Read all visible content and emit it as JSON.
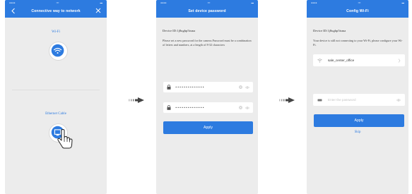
{
  "colors": {
    "accent": "#2d7be0",
    "background": "#ececec",
    "field": "#ffffff"
  },
  "screen1": {
    "title": "Connective way to network",
    "wifi_label": "Wi-Fi",
    "ethernet_label": "Ethernet Cable",
    "icons": [
      "back-chevron-icon",
      "close-icon",
      "wifi-icon",
      "ethernet-icon",
      "hand-pointer-icon"
    ]
  },
  "screen2": {
    "title": "Set device password",
    "device_id": "Device ID:1j8ughp5tsma",
    "description": "Please set a new password for the camera.Password must be a combination of letters and numbers, at a length of 8-32 characters",
    "password_mask": "••••••••••••••",
    "confirm_mask": "••••••••••••••",
    "apply_label": "Apply",
    "icons": [
      "lock-icon",
      "clear-icon",
      "eye-icon"
    ]
  },
  "screen3": {
    "title": "Config Wi-Fi",
    "device_id": "Device ID:1j8ughp5tsma",
    "description": "Your device is still not connecting to your Wi-Fi, please configure your Wi-Fi.",
    "ssid": "sale_center_office",
    "password_placeholder": "Enter the password",
    "apply_label": "Apply",
    "skip_label": "Skip",
    "icons": [
      "wifi-small-icon",
      "chevron-right-icon",
      "key-icon",
      "eye-icon"
    ]
  },
  "flow_arrows": [
    "arrow-right-icon",
    "arrow-right-icon"
  ]
}
